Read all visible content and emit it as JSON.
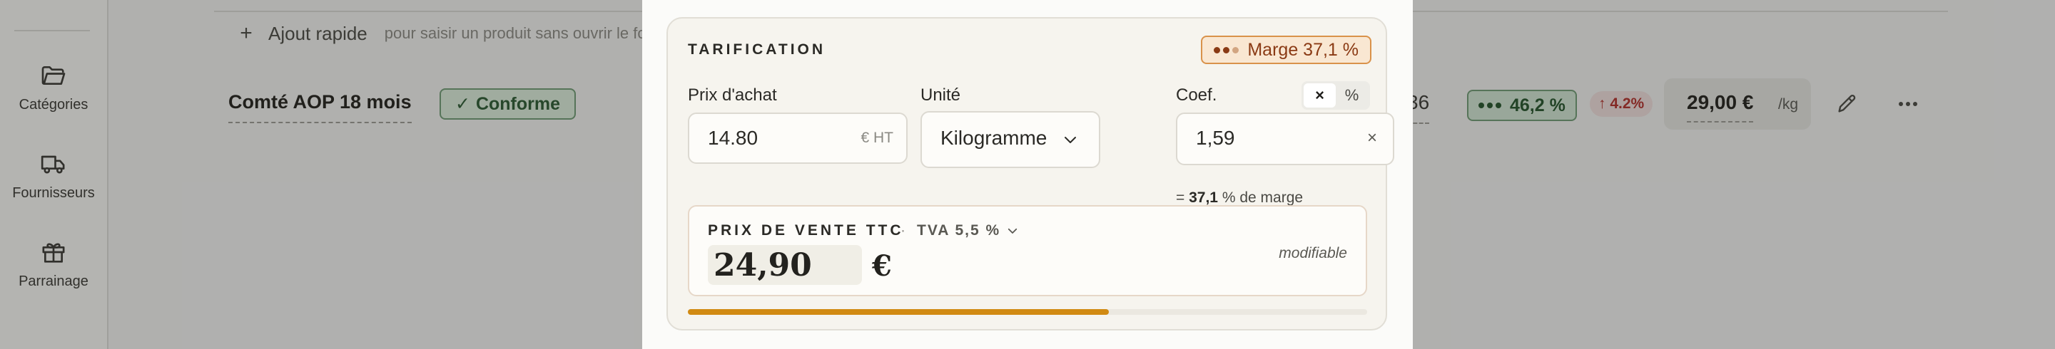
{
  "sidebar": {
    "items": [
      {
        "label": "Catégories",
        "icon": "folder-icon"
      },
      {
        "label": "Fournisseurs",
        "icon": "truck-icon"
      },
      {
        "label": "Parrainage",
        "icon": "gift-icon"
      }
    ]
  },
  "quick_add": {
    "label": "Ajout rapide",
    "hint": "pour saisir un produit sans ouvrir le fo"
  },
  "product_row": {
    "name": "Comté AOP 18 mois",
    "status": "Conforme",
    "partial_value": "36",
    "margin": "46,2 %",
    "trend": "↑ 4.2%",
    "price": "29,00 €",
    "unit": "/kg"
  },
  "pricing": {
    "title": "TARIFICATION",
    "margin_badge": "Marge 37,1 %",
    "purchase_label": "Prix d'achat",
    "purchase_value": "14.80",
    "purchase_suffix": "€ HT",
    "unit_label": "Unité",
    "unit_value": "Kilogramme",
    "coef_label": "Coef.",
    "coef_modes": [
      "×",
      "%"
    ],
    "coef_active": "×",
    "coef_value": "1,59",
    "coef_clear": "×",
    "margin_note_prefix": "=",
    "margin_note_value": "37,1",
    "margin_note_suffix": "% de marge",
    "sale_title": "PRIX DE VENTE TTC",
    "sale_sep": "·",
    "tva_label": "TVA 5,5 %",
    "sale_value": "24,90",
    "currency": "€",
    "editable_note": "modifiable",
    "margin_progress": 0.62
  },
  "colors": {
    "accent_orange": "#d18a12",
    "success_green": "#24542c",
    "danger_red": "#b0302c",
    "margin_brown": "#8a3a14"
  }
}
